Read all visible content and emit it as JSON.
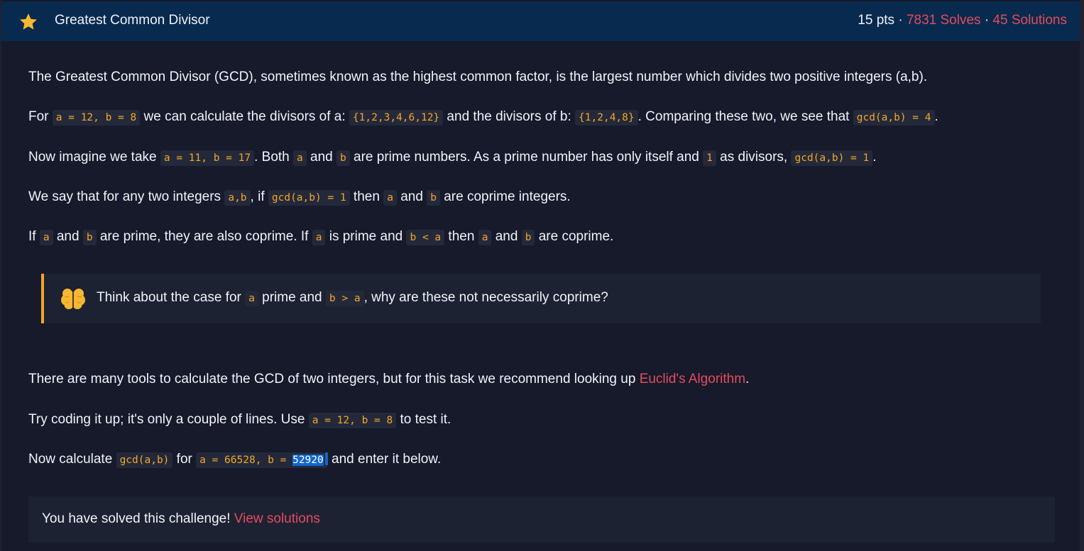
{
  "header": {
    "title": "Greatest Common Divisor",
    "points": "15 pts",
    "separator": "·",
    "solves": "7831 Solves",
    "solutions": "45 Solutions"
  },
  "content": {
    "p1": "The Greatest Common Divisor (GCD), sometimes known as the highest common factor, is the largest number which divides two positive integers (a,b).",
    "p2": {
      "t1": "For ",
      "c1": "a = 12, b = 8",
      "t2": " we can calculate the divisors of a: ",
      "c2": "{1,2,3,4,6,12}",
      "t3": " and the divisors of b: ",
      "c3": "{1,2,4,8}",
      "t4": ". Comparing these two, we see that ",
      "c4": "gcd(a,b) = 4",
      "t5": "."
    },
    "p3": {
      "t1": "Now imagine we take ",
      "c1": "a = 11, b = 17",
      "t2": ". Both ",
      "c2": "a",
      "t3": " and ",
      "c3": "b",
      "t4": " are prime numbers. As a prime number has only itself and ",
      "c4": "1",
      "t5": " as divisors, ",
      "c5": "gcd(a,b) = 1",
      "t6": "."
    },
    "p4": {
      "t1": "We say that for any two integers ",
      "c1": "a,b",
      "t2": ", if ",
      "c2": "gcd(a,b) = 1",
      "t3": " then ",
      "c3": "a",
      "t4": " and ",
      "c4": "b",
      "t5": " are coprime integers."
    },
    "p5": {
      "t1": "If ",
      "c1": "a",
      "t2": " and ",
      "c2": "b",
      "t3": " are prime, they are also coprime. If ",
      "c3": "a",
      "t4": " is prime and ",
      "c4": "b < a",
      "t5": " then ",
      "c5": "a",
      "t6": " and ",
      "c6": "b",
      "t7": " are coprime."
    },
    "callout": {
      "icon": "brain-icon",
      "t1": "Think about the case for ",
      "c1": "a",
      "t2": " prime and ",
      "c2": "b > a",
      "t3": ", why are these not necessarily coprime?"
    },
    "p6": {
      "t1": "There are many tools to calculate the GCD of two integers, but for this task we recommend looking up ",
      "link": "Euclid's Algorithm",
      "t2": "."
    },
    "p7": {
      "t1": "Try coding it up; it's only a couple of lines. Use ",
      "c1": "a = 12, b = 8",
      "t2": " to test it."
    },
    "p8": {
      "t1": "Now calculate ",
      "c1": "gcd(a,b)",
      "t2": " for ",
      "c2_pre": "a = 66528, b = ",
      "c2_sel": "52920",
      "t3": " and enter it below."
    },
    "solved": {
      "text": "You have solved this challenge! ",
      "link": "View solutions"
    }
  },
  "colors": {
    "header_bg": "#082a4e",
    "page_bg": "#161a2b",
    "code_fg": "#f5a524",
    "code_bg": "#23293b",
    "accent_red": "#e24c5c",
    "callout_border": "#f5a524",
    "selection": "#1266c9"
  }
}
